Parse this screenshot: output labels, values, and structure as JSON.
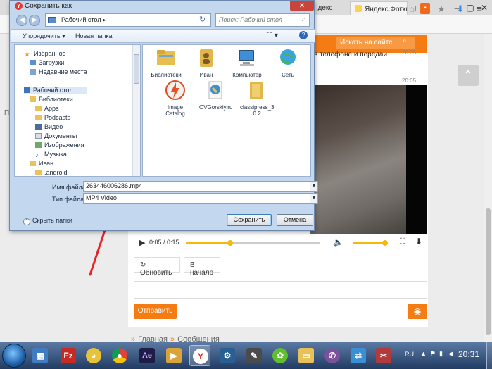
{
  "browser": {
    "tab_label": "Яндекс.Фотки",
    "tab_partial_label": "ндекс",
    "address_right_icons": [
      "star-icon",
      "download-arrow-icon",
      "menu-icon"
    ],
    "left_gutter_text": "П"
  },
  "site": {
    "search_placeholder": "Искать на сайте",
    "message_snippet": "в телефоне и передаи",
    "time_1": "20:05",
    "time_2": "20:05",
    "video": {
      "time_label": "0:05 / 0:15",
      "progress_fraction": 0.33,
      "volume_fraction": 0.9
    },
    "refresh_label": "Обновить",
    "start_label": "В начало",
    "send_label": "Отправить",
    "breadcrumb": [
      "Главная",
      "Сообщения"
    ],
    "accent_color": "#f57c13"
  },
  "dialog": {
    "title": "Сохранить как",
    "path": "Рабочий стол",
    "search_placeholder": "Поиск: Рабочий стол",
    "organize_label": "Упорядочить",
    "new_folder_label": "Новая папка",
    "nav_items": [
      {
        "label": "Избранное",
        "icon": "star-icon"
      },
      {
        "label": "Загрузки",
        "icon": "downloads-icon"
      },
      {
        "label": "Недавние места",
        "icon": "recent-places-icon"
      },
      {
        "label": "Рабочий стол",
        "icon": "desktop-icon"
      },
      {
        "label": "Библиотеки",
        "icon": "libraries-icon"
      },
      {
        "label": "Apps",
        "icon": "folder-icon"
      },
      {
        "label": "Podcasts",
        "icon": "folder-icon"
      },
      {
        "label": "Видео",
        "icon": "video-library-icon"
      },
      {
        "label": "Документы",
        "icon": "documents-icon"
      },
      {
        "label": "Изображения",
        "icon": "images-icon"
      },
      {
        "label": "Музыка",
        "icon": "music-icon"
      },
      {
        "label": "Иван",
        "icon": "user-folder-icon"
      },
      {
        "label": ".android",
        "icon": "folder-icon"
      }
    ],
    "files": [
      {
        "label": "Библиотеки",
        "icon": "libraries-icon"
      },
      {
        "label": "Иван",
        "icon": "user-folder-icon"
      },
      {
        "label": "Компьютер",
        "icon": "computer-icon"
      },
      {
        "label": "Сеть",
        "icon": "network-icon"
      },
      {
        "label": "Image Catalog",
        "icon": "image-catalog-icon"
      },
      {
        "label": "OVGorskiy.ru",
        "icon": "shortcut-icon"
      },
      {
        "label": "classipress_3 .0.2",
        "icon": "folder-icon"
      }
    ],
    "filename_label": "Имя файла:",
    "filename_value": "263446006286.mp4",
    "filetype_label": "Тип файла:",
    "filetype_value": "MP4 Video",
    "hide_folders_label": "Скрыть папки",
    "save_label": "Сохранить",
    "cancel_label": "Отмена"
  },
  "taskbar": {
    "apps": [
      "explorer-icon",
      "filezilla-icon",
      "bird-app-icon",
      "chrome-icon",
      "after-effects-icon",
      "media-icon",
      "yandex-browser-icon",
      "gear-app-icon",
      "wolf-app-icon",
      "icq-icon",
      "folder-icon",
      "viber-icon",
      "network-app-icon",
      "screenshot-tool-icon"
    ],
    "active_app": "yandex-browser-icon",
    "lang": "RU",
    "clock": "20:31"
  }
}
